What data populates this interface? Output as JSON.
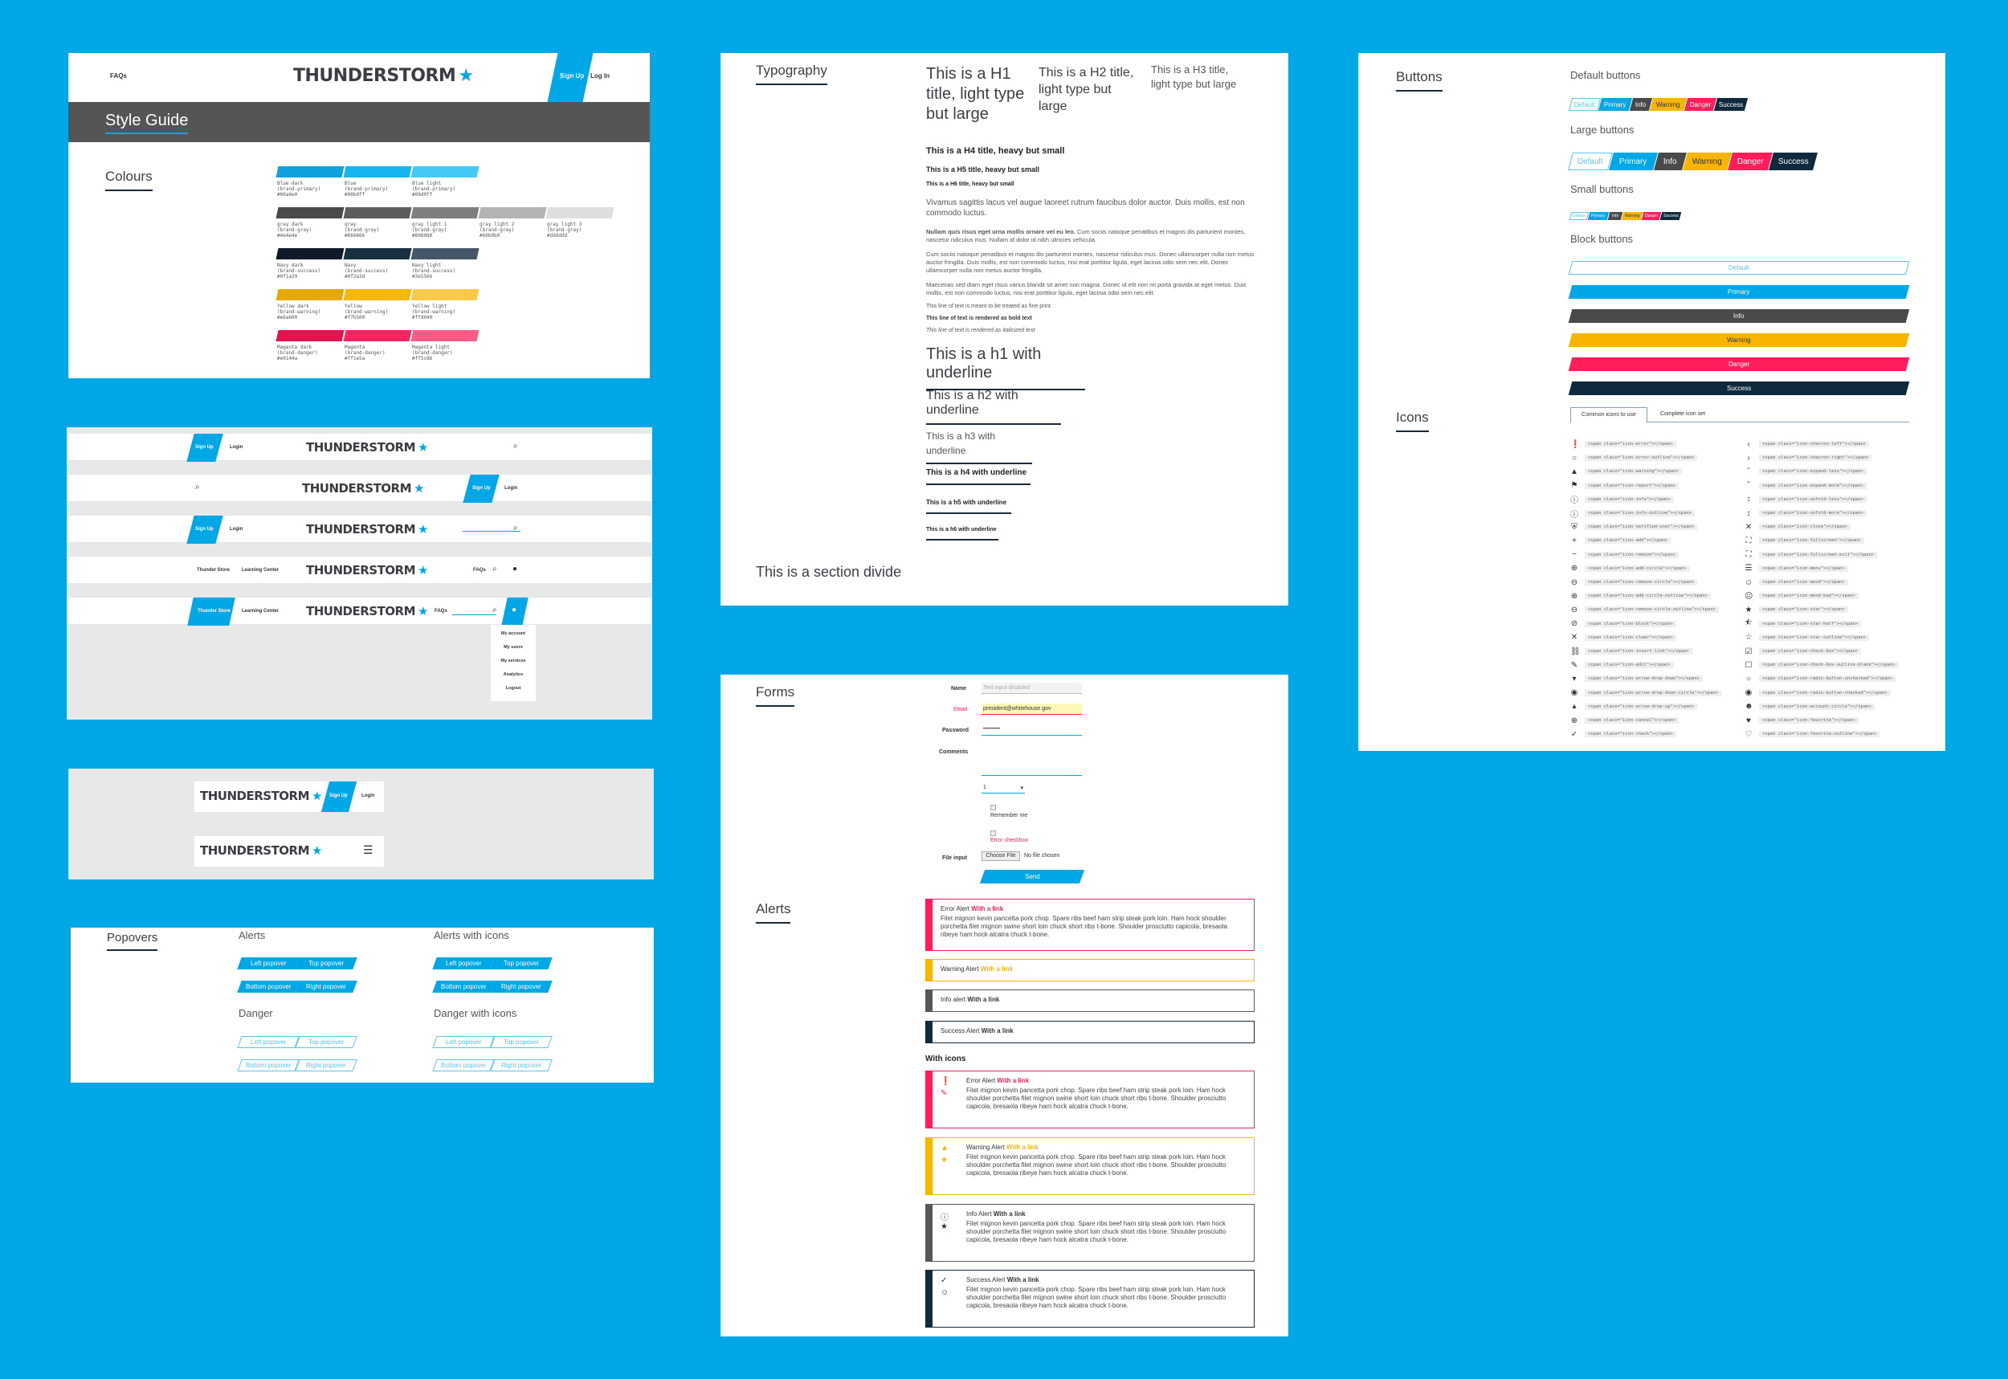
{
  "colors": {
    "brand": "#00a7e6",
    "brand_light": "#4cc8f4",
    "gray_dark": "#575757",
    "navy": "#0f2a3d",
    "yellow": "#f7b500",
    "magenta": "#ff1e5a",
    "bg": "#00a7e6"
  },
  "style_guide": {
    "nav": {
      "faqs": "FAQs",
      "signup": "Sign Up",
      "login": "Log In"
    },
    "logo": "THUNDERSTORM",
    "title": "Style Guide",
    "colours_title": "Colours",
    "swatch_rows": [
      [
        {
          "name": "Blue dark",
          "var": "(brand-primary)",
          "hex": "#00a0e0",
          "c": "#0ea2e0"
        },
        {
          "name": "Blue",
          "var": "(brand-primary)",
          "hex": "#00b0ff",
          "c": "#16b4f0"
        },
        {
          "name": "Blue light",
          "var": "(brand-primary)",
          "hex": "#00d0ff",
          "c": "#43c9f6"
        }
      ],
      [
        {
          "name": "gray dark",
          "var": "(brand-gray)",
          "hex": "#4e4e4e",
          "c": "#4a4a4a"
        },
        {
          "name": "gray",
          "var": "(brand-gray)",
          "hex": "#666666",
          "c": "#5d5d5d"
        },
        {
          "name": "gray light 1",
          "var": "(brand-gray)",
          "hex": "#808080",
          "c": "#7f7f7f"
        },
        {
          "name": "gray light 2",
          "var": "(brand-gray)",
          "hex": "#b0b0b0",
          "c": "#b3b3b3"
        },
        {
          "name": "gray light 3",
          "var": "(brand-gray)",
          "hex": "#dddddd",
          "c": "#dedede"
        }
      ],
      [
        {
          "name": "Navy dark",
          "var": "(brand-success)",
          "hex": "#0f1a29",
          "c": "#0f1b28"
        },
        {
          "name": "Navy",
          "var": "(brand-success)",
          "hex": "#0f2a3d",
          "c": "#173040"
        },
        {
          "name": "Navy light",
          "var": "(brand-success)",
          "hex": "#3e5566",
          "c": "#435768"
        }
      ],
      [
        {
          "name": "Yellow dark",
          "var": "(brand-warning)",
          "hex": "#e6a600",
          "c": "#e7a800"
        },
        {
          "name": "Yellow",
          "var": "(brand-warning)",
          "hex": "#f7b500",
          "c": "#f7b800"
        },
        {
          "name": "Yellow light",
          "var": "(brand-warning)",
          "hex": "#ffd040",
          "c": "#fdc94b"
        }
      ],
      [
        {
          "name": "Magenta dark",
          "var": "(brand-danger)",
          "hex": "#e0144a",
          "c": "#e2134d"
        },
        {
          "name": "Magenta",
          "var": "(brand-danger)",
          "hex": "#ff1e5a",
          "c": "#fb2461"
        },
        {
          "name": "Magenta light",
          "var": "(brand-danger)",
          "hex": "#ff5c86",
          "c": "#fd5b85"
        }
      ]
    ]
  },
  "headers": {
    "signup": "Sign Up",
    "login": "Login",
    "faqs": "FAQs",
    "thunder_store": "Thunder Store",
    "learning_center": "Learning Center",
    "dropdown": [
      "My account",
      "My users",
      "My services",
      "Analytics",
      "Logout"
    ]
  },
  "typography": {
    "title": "Typography",
    "h1": "This is a H1 title, light type but large",
    "h2": "This is a H2 title, light type but large",
    "h3": "This is a H3 title, light type but large",
    "h4": "This is a H4 title, heavy but small",
    "h5": "This is a H5 title, heavy but small",
    "h6": "This is a H6 title, heavy but small",
    "lead": "Vivamus sagittis lacus vel augue laoreet rutrum faucibus dolor auctor. Duis mollis, est non commodo luctus.",
    "p1_bold": "Nullam quis risus eget urna mollis ornare vel eu leo.",
    "p1": " Cum sociis natoque penatibus et magnis dis parturient montes, nascetur ridiculus mus. Nullam id dolor id nibh ultricies vehicula.",
    "p2": "Cum sociis natoque penatibus et magnis dis parturient montes, nascetur ridiculus mus. Donec ullamcorper nulla non metus auctor fringilla. Duis mollis, est non commodo luctus, nisi erat porttitor ligula, eget lacinia odio sem nec elit. Donec ullamcorper nulla non metus auctor fringilla.",
    "p3": "Maecenas sed diam eget risus varius blandit sit amet non magna. Donec id elit non mi porta gravida at eget metus. Duis mollis, est non commodo luctus, nisi erat porttitor ligula, eget lacinia odio sem nec elit.",
    "small1": "This line of text is meant to be treated as fine print.",
    "small2": "This line of text is rendered as bold text",
    "small3": "This line of text is rendered as italicized text",
    "uh1": "This is a h1 with underline",
    "uh2": "This is a h2 with underline",
    "uh3": "This is a h3 with underline",
    "uh4": "This is a h4 with underline",
    "uh5": "This is a h5 with underline",
    "uh6": "This is a h6 with underline",
    "divide": "This is a section divide"
  },
  "forms": {
    "title": "Forms",
    "name_label": "Name",
    "name_placeholder": "Text input disabled",
    "email_label": "Email",
    "email_value": "president@whitehouse.gov",
    "password_label": "Password",
    "password_value": "••••••••••",
    "comments_label": "Comments",
    "select_value": "1",
    "remember": "Remember me",
    "error_checkbox": "Error checkbox",
    "file_label": "File input",
    "file_button": "Choose File",
    "file_none": "No file chosen",
    "send": "Send"
  },
  "alerts": {
    "title": "Alerts",
    "body": "Filet mignon kevin pancetta pork chop. Spare ribs beef ham strip steak pork loin. Ham hock shoulder porchetta filet mignon swine short loin chuck short ribs t-bone. Shoulder prosciutto capicola, bresaola ribeye ham hock alcatra chuck t-bone.",
    "link": "With a link",
    "error": "Error Alert",
    "warning": "Warning Alert",
    "info": "Info alert",
    "success": "Success Alert",
    "with_icons": "With icons",
    "info_icon": "Info Alert"
  },
  "buttons": {
    "title": "Buttons",
    "default_h": "Default buttons",
    "large_h": "Large buttons",
    "small_h": "Small buttons",
    "block_h": "Block buttons",
    "labels": [
      "Default",
      "Primary",
      "Info",
      "Warning",
      "Danger",
      "Success"
    ]
  },
  "icons": {
    "title": "Icons",
    "tab1": "Common icons to use",
    "tab2": "Complete icon set",
    "left": [
      {
        "g": "❗",
        "c": "<span class=\"icon-error\"></span>"
      },
      {
        "g": "○",
        "c": "<span class=\"icon-error-outline\"></span>"
      },
      {
        "g": "▲",
        "c": "<span class=\"icon-warning\"></span>"
      },
      {
        "g": "⚑",
        "c": "<span class=\"icon-report\"></span>"
      },
      {
        "g": "ⓘ",
        "c": "<span class=\"icon-info\"></span>"
      },
      {
        "g": "ⓘ",
        "c": "<span class=\"icon-info-outline\"></span>"
      },
      {
        "g": "⛨",
        "c": "<span class=\"icon-verified-user\"></span>"
      },
      {
        "g": "+",
        "c": "<span class=\"icon-add\"></span>"
      },
      {
        "g": "−",
        "c": "<span class=\"icon-remove\"></span>"
      },
      {
        "g": "⊕",
        "c": "<span class=\"icon-add-circle\"></span>"
      },
      {
        "g": "⊖",
        "c": "<span class=\"icon-remove-circle\"></span>"
      },
      {
        "g": "⊕",
        "c": "<span class=\"icon-add-circle-outline\"></span>"
      },
      {
        "g": "⊖",
        "c": "<span class=\"icon-remove-circle-outline\"></span>"
      },
      {
        "g": "⊘",
        "c": "<span class=\"icon-block\"></span>"
      },
      {
        "g": "✕",
        "c": "<span class=\"icon-clear\"></span>"
      },
      {
        "g": "⛓",
        "c": "<span class=\"icon-insert-link\"></span>"
      },
      {
        "g": "✎",
        "c": "<span class=\"icon-edit\"></span>"
      },
      {
        "g": "▾",
        "c": "<span class=\"icon-arrow-drop-down\"></span>"
      },
      {
        "g": "◉",
        "c": "<span class=\"icon-arrow-drop-down-circle\"></span>"
      },
      {
        "g": "▴",
        "c": "<span class=\"icon-arrow-drop-up\"></span>"
      },
      {
        "g": "⊗",
        "c": "<span class=\"icon-cancel\"></span>"
      },
      {
        "g": "✓",
        "c": "<span class=\"icon-check\"></span>"
      }
    ],
    "right": [
      {
        "g": "‹",
        "c": "<span class=\"icon-chevron-left\"></span>"
      },
      {
        "g": "›",
        "c": "<span class=\"icon-chevron-right\"></span>"
      },
      {
        "g": "ˆ",
        "c": "<span class=\"icon-expand-less\"></span>"
      },
      {
        "g": "ˇ",
        "c": "<span class=\"icon-expand-more\"></span>"
      },
      {
        "g": "↕",
        "c": "<span class=\"icon-unfold-less\"></span>"
      },
      {
        "g": "↕",
        "c": "<span class=\"icon-unfold-more\"></span>"
      },
      {
        "g": "✕",
        "c": "<span class=\"icon-close\"></span>"
      },
      {
        "g": "⛶",
        "c": "<span class=\"icon-fullscreen\"></span>"
      },
      {
        "g": "⛶",
        "c": "<span class=\"icon-fullscreen-exit\"></span>"
      },
      {
        "g": "☰",
        "c": "<span class=\"icon-menu\"></span>"
      },
      {
        "g": "☺",
        "c": "<span class=\"icon-mood\"></span>"
      },
      {
        "g": "☹",
        "c": "<span class=\"icon-mood-bad\"></span>"
      },
      {
        "g": "★",
        "c": "<span class=\"icon-star\"></span>"
      },
      {
        "g": "⯪",
        "c": "<span class=\"icon-star-half\"></span>"
      },
      {
        "g": "☆",
        "c": "<span class=\"icon-star-outline\"></span>"
      },
      {
        "g": "☑",
        "c": "<span class=\"icon-check-box\"></span>"
      },
      {
        "g": "☐",
        "c": "<span class=\"icon-check-box-outline-blank\"></span>"
      },
      {
        "g": "○",
        "c": "<span class=\"icon-radio-button-unchecked\"></span>"
      },
      {
        "g": "◉",
        "c": "<span class=\"icon-radio-button-checked\"></span>"
      },
      {
        "g": "☻",
        "c": "<span class=\"icon-account-circle\"></span>"
      },
      {
        "g": "♥",
        "c": "<span class=\"icon-favorite\"></span>"
      },
      {
        "g": "♡",
        "c": "<span class=\"icon-favorite-outline\"></span>"
      }
    ]
  },
  "popovers": {
    "title": "Popovers",
    "alerts": "Alerts",
    "alerts_icons": "Alerts with icons",
    "danger": "Danger",
    "danger_icons": "Danger with icons",
    "left": "Left popover",
    "top": "Top popover",
    "bottom": "Bottom popover",
    "right": "Right popover"
  }
}
